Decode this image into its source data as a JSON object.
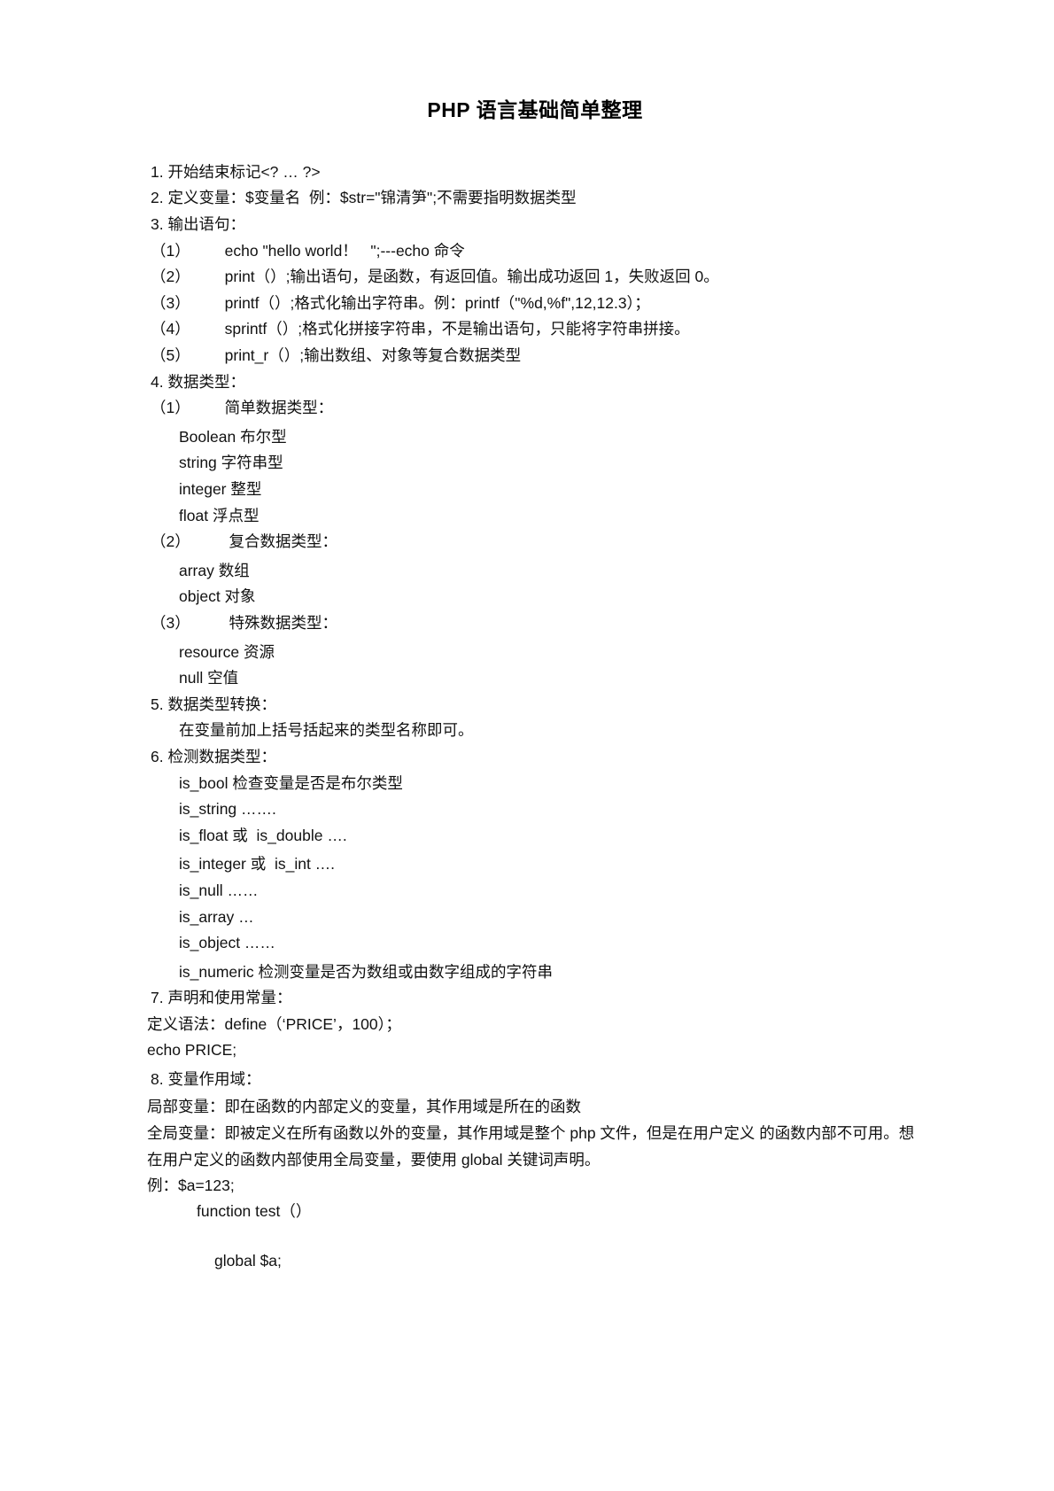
{
  "document": {
    "title": "PHP 语言基础简单整理",
    "sections": [
      {
        "id": "s1",
        "level": "num",
        "text": "1. 开始结束标记<? … ?>"
      },
      {
        "id": "s2",
        "level": "num",
        "text": "2. 定义变量：$变量名  例：$str=\"锦清笋\";不需要指明数据类型"
      },
      {
        "id": "s3",
        "level": "num",
        "text": "3. 输出语句："
      },
      {
        "id": "s3a",
        "level": "paren",
        "text": "（1）        echo \"hello world！   \";---echo 命令"
      },
      {
        "id": "s3b",
        "level": "paren",
        "text": "（2）        print（）;输出语句，是函数，有返回值。输出成功返回 1，失败返回 0。"
      },
      {
        "id": "s3c",
        "level": "paren",
        "text": "（3）        printf（）;格式化输出字符串。例：printf（\"%d,%f\",12,12.3）；"
      },
      {
        "id": "s3d",
        "level": "paren",
        "text": "（4）        sprintf（）;格式化拼接字符串，不是输出语句，只能将字符串拼接。"
      },
      {
        "id": "s3e",
        "level": "paren",
        "text": "（5）        print_r（）;输出数组、对象等复合数据类型"
      },
      {
        "id": "s4",
        "level": "num",
        "text": "4. 数据类型："
      },
      {
        "id": "s4a",
        "level": "paren",
        "text": "（1）        简单数据类型："
      },
      {
        "id": "s4a1",
        "level": "item",
        "text": "Boolean 布尔型"
      },
      {
        "id": "s4a2",
        "level": "item",
        "text": "string 字符串型"
      },
      {
        "id": "s4a3",
        "level": "item",
        "text": "integer 整型"
      },
      {
        "id": "s4a4",
        "level": "item",
        "text": "float 浮点型"
      },
      {
        "id": "s4b",
        "level": "paren",
        "text": "（2）         复合数据类型："
      },
      {
        "id": "s4b1",
        "level": "item",
        "text": "array 数组"
      },
      {
        "id": "s4b2",
        "level": "item",
        "text": "object 对象"
      },
      {
        "id": "s4c",
        "level": "paren",
        "text": "（3）         特殊数据类型："
      },
      {
        "id": "s4c1",
        "level": "item",
        "text": "resource 资源"
      },
      {
        "id": "s4c2",
        "level": "item",
        "text": "null 空值"
      },
      {
        "id": "s5",
        "level": "num",
        "text": "5. 数据类型转换："
      },
      {
        "id": "s5a",
        "level": "item",
        "text": "在变量前加上括号括起来的类型名称即可。"
      },
      {
        "id": "s6",
        "level": "num",
        "text": "6. 检测数据类型："
      },
      {
        "id": "s6a",
        "level": "item",
        "text": "is_bool 检查变量是否是布尔类型"
      },
      {
        "id": "s6b",
        "level": "item",
        "text": "is_string ……."
      },
      {
        "id": "s6c",
        "level": "item",
        "text": "is_float 或  is_double …."
      },
      {
        "id": "s6d",
        "level": "item",
        "text": "is_integer 或  is_int …."
      },
      {
        "id": "s6e",
        "level": "item",
        "text": "is_null ……"
      },
      {
        "id": "s6f",
        "level": "item",
        "text": "is_array …"
      },
      {
        "id": "s6g",
        "level": "item",
        "text": "is_object ……"
      },
      {
        "id": "s6h",
        "level": "item",
        "text": "is_numeric 检测变量是否为数组或由数字组成的字符串"
      },
      {
        "id": "s7",
        "level": "num",
        "text": "7. 声明和使用常量："
      },
      {
        "id": "s7a",
        "level": "flush",
        "text": "定义语法：define（‘PRICE’，100）；"
      },
      {
        "id": "s7b",
        "level": "flush",
        "text": "echo PRICE;"
      },
      {
        "id": "s8",
        "level": "num",
        "text": "8. 变量作用域："
      }
    ],
    "scope_paragraphs": [
      "局部变量：即在函数的内部定义的变量，其作用域是所在的函数",
      "全局变量：即被定义在所有函数以外的变量，其作用域是整个 php 文件，但是在用户定义 的函数内部不可用。想在用户定义的函数内部使用全局变量，要使用 global 关键词声明。"
    ],
    "example": {
      "line1": "例：$a=123;",
      "line2": "function test（）",
      "line3": "global $a;"
    }
  }
}
